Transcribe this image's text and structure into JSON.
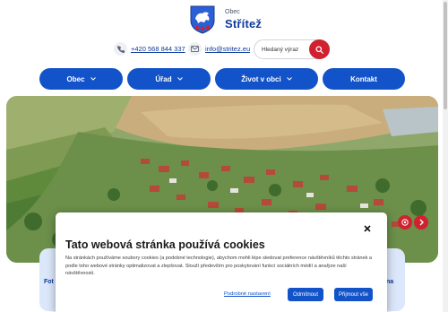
{
  "header": {
    "label_small": "Obec",
    "name": "Střítež",
    "phone": "+420 568 844 337",
    "email": "info@stritez.eu",
    "search_placeholder": "Hledaný výraz"
  },
  "nav": {
    "items": [
      {
        "label": "Obec",
        "has_dropdown": true
      },
      {
        "label": "Úřad",
        "has_dropdown": true
      },
      {
        "label": "Život v obci",
        "has_dropdown": true
      },
      {
        "label": "Kontakt",
        "has_dropdown": false
      }
    ]
  },
  "tiles": {
    "left_text": "Fot",
    "right_text": "na"
  },
  "cookie": {
    "title": "Tato webová stránka používá cookies",
    "text": "Na stránkách používáme soubory cookies (a podobné technologie), abychom mohli lépe sledovat preference návštěvníků těchto stránek a podle toho webové stránky optimalizovat a zlepšovat. Slouží především pro poskytování funkcí sociálních médií a analýze naší návštěvnosti.",
    "settings_label": "Podrobné nastavení",
    "reject_label": "Odmítnout",
    "accept_label": "Přijmout vše"
  },
  "colors": {
    "primary": "#1253c9",
    "accent_red": "#d0212f",
    "title_blue": "#0d3a9c"
  },
  "icons": [
    "phone-icon",
    "mail-icon",
    "search-icon",
    "chevron-down-icon",
    "arrow-left-icon",
    "arrow-right-icon",
    "close-icon",
    "crest-icon"
  ]
}
